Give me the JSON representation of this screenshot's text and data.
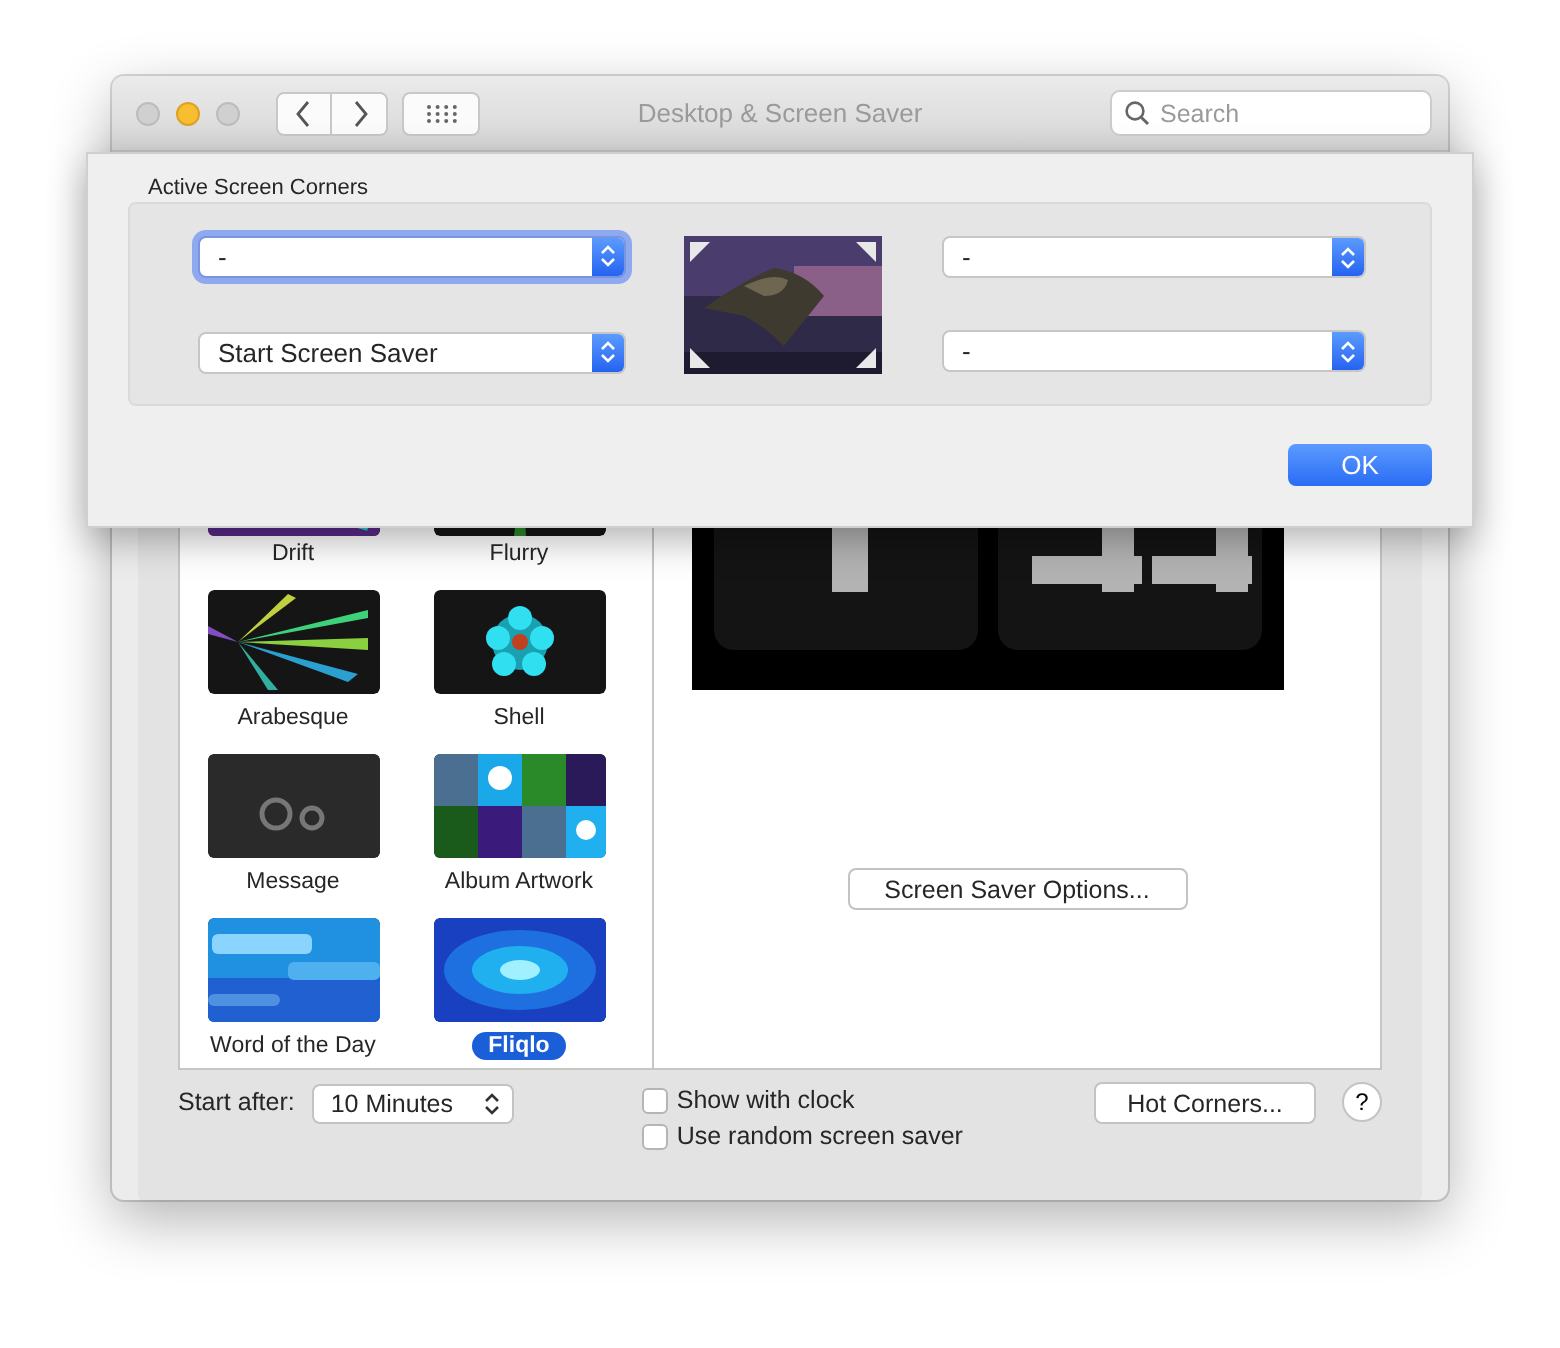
{
  "window": {
    "title": "Desktop & Screen Saver"
  },
  "search": {
    "placeholder": "Search"
  },
  "sheet": {
    "title": "Active Screen Corners",
    "corners": [
      {
        "value": "-",
        "focused": true
      },
      {
        "value": "Start Screen Saver",
        "focused": false
      },
      {
        "value": "-",
        "focused": false
      },
      {
        "value": "-",
        "focused": false
      }
    ],
    "ok": "OK"
  },
  "screen_savers": [
    {
      "name": "Drift",
      "selected": false
    },
    {
      "name": "Flurry",
      "selected": false
    },
    {
      "name": "Arabesque",
      "selected": false
    },
    {
      "name": "Shell",
      "selected": false
    },
    {
      "name": "Message",
      "selected": false
    },
    {
      "name": "Album Artwork",
      "selected": false
    },
    {
      "name": "Word of the Day",
      "selected": false
    },
    {
      "name": "Fliqlo",
      "selected": true
    }
  ],
  "options_button": "Screen Saver Options...",
  "start_after": {
    "label": "Start after:",
    "value": "10 Minutes"
  },
  "checkboxes": [
    {
      "label": "Show with clock",
      "checked": false
    },
    {
      "label": "Use random screen saver",
      "checked": false
    }
  ],
  "hot_corners_button": "Hot Corners...",
  "help": "?"
}
